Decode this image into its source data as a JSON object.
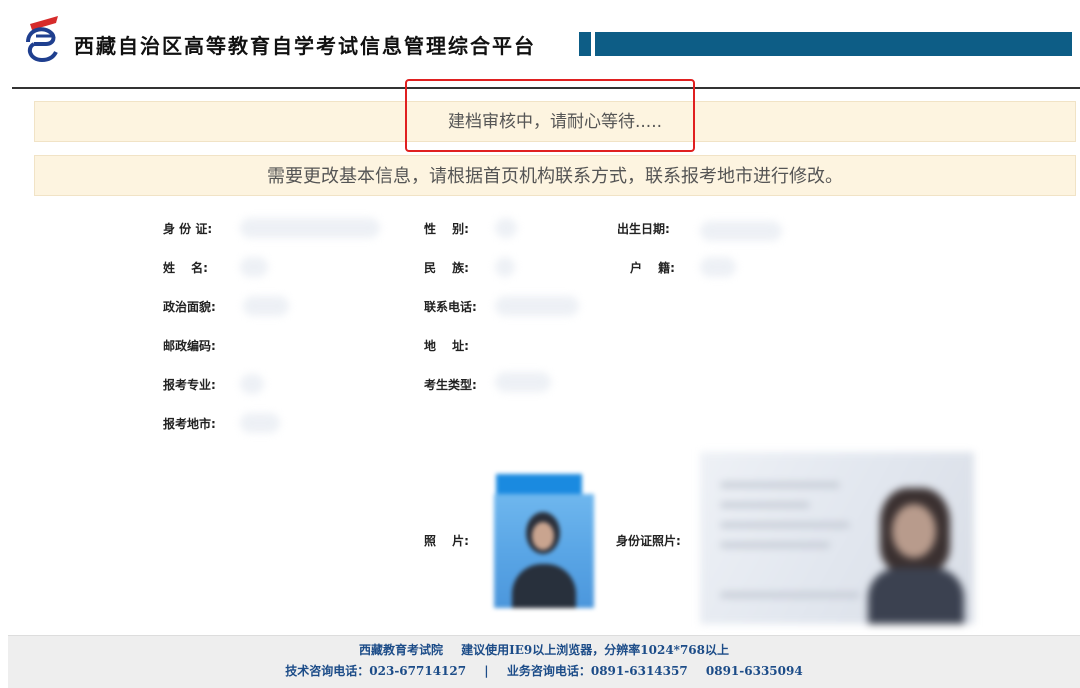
{
  "header": {
    "site_title": "西藏自治区高等教育自学考试信息管理综合平台",
    "accent_color": "#0d5d86",
    "logo_icon": "zikao-logo-icon"
  },
  "notices": {
    "status_text": "建档审核中，请耐心等待.....",
    "edit_hint": "需要更改基本信息，请根据首页机构联系方式，联系报考地市进行修改。",
    "highlight_color": "#e02020"
  },
  "form": {
    "id_card_label": "身 份 证:",
    "gender_label": "性　 别:",
    "birthdate_label": "出生日期:",
    "name_label": "姓　 名:",
    "ethnicity_label": "民　 族:",
    "household_label": "户　 籍:",
    "political_label": "政治面貌:",
    "phone_label": "联系电话:",
    "postcode_label": "邮政编码:",
    "address_label": "地　 址:",
    "major_label": "报考专业:",
    "candidate_type_label": "考生类型:",
    "exam_city_label": "报考地市:",
    "photo_label": "照　 片:",
    "id_photo_label": "身份证照片:"
  },
  "footer": {
    "org_name": "西藏教育考试院",
    "browser_hint": "建议使用IE9以上浏览器，分辨率1024*768以上",
    "tech_phone": "技术咨询电话：023-67714127",
    "separator": "|",
    "business_phone_1": "业务咨询电话：0891-6314357",
    "business_phone_2": "0891-6335094",
    "text_color": "#1c4c88"
  }
}
